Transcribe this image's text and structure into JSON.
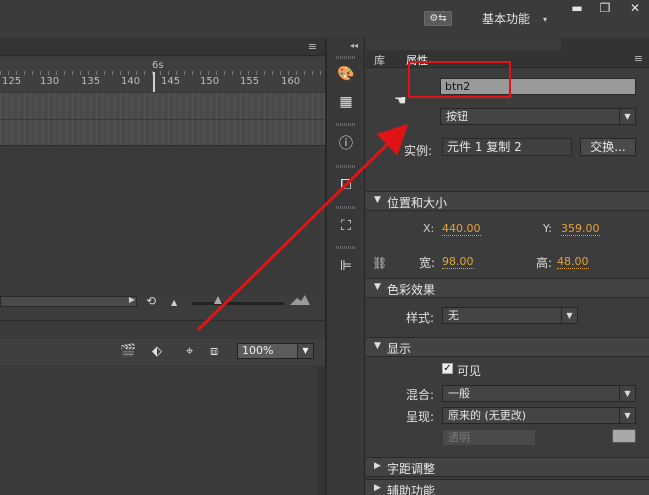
{
  "titlebar": {
    "workspace_icon": "⚙⇆",
    "workspace_label": "基本功能",
    "workspace_arrow": "▾",
    "minimize": "▬",
    "restore": "❐",
    "close": "✕"
  },
  "timeline": {
    "menu_icon": "≡",
    "seconds_marker": "6s",
    "ticks": [
      "125",
      "130",
      "135",
      "140",
      "145",
      "150",
      "155",
      "160"
    ],
    "controls": {
      "loop": "⟲",
      "shrink": "▲",
      "grow": "▲"
    }
  },
  "stage": {
    "zoom_value": "100%",
    "icons": [
      "clapper-icon",
      "symbol-icon",
      "center-stage-icon",
      "clip-icon"
    ]
  },
  "dock": {
    "collapse": "◂◂",
    "icons": [
      "color-icon",
      "swatches-icon",
      "info-icon",
      "transform-icon",
      "align-icon",
      "align-left-icon"
    ]
  },
  "properties": {
    "tabs": [
      "库",
      "属性"
    ],
    "menu_icon": "≡",
    "instance_name": "btn2",
    "instance_type": "按钮",
    "instance_label": "实例:",
    "instance_of": "元件 1 复制 2",
    "swap_button": "交换...",
    "sections": {
      "position_size": "位置和大小",
      "color_effect": "色彩效果",
      "display": "显示",
      "tracking": "字距调整",
      "accessibility": "辅助功能"
    },
    "position": {
      "x_label": "X:",
      "x": "440.00",
      "y_label": "Y:",
      "y": "359.00"
    },
    "size": {
      "w_label": "宽:",
      "w": "98.00",
      "h_label": "高:",
      "h": "48.00"
    },
    "style_label": "样式:",
    "style_value": "无",
    "visible_label": "可见",
    "visible_checked": "✓",
    "blend_label": "混合:",
    "blend_value": "一般",
    "render_label": "呈现:",
    "render_value": "原来的 (无更改)",
    "transparent_value": "透明",
    "value_color": "#e3a23a"
  },
  "annotation": {
    "color": "#e01414"
  }
}
